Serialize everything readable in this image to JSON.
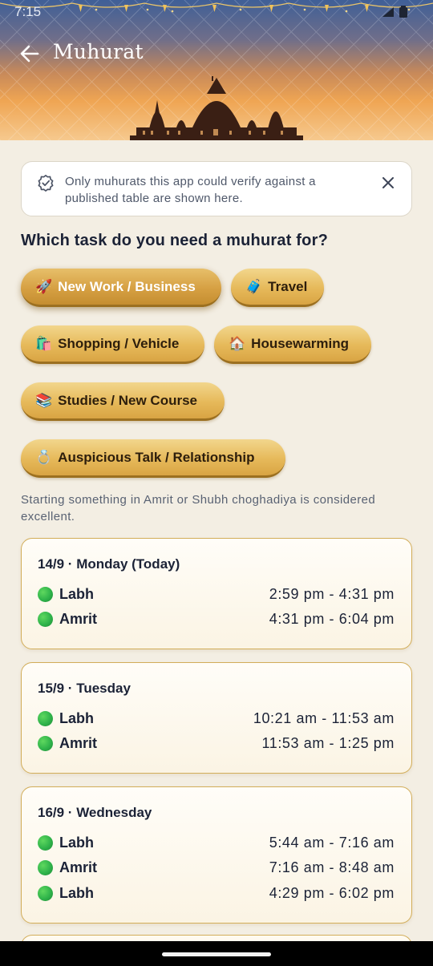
{
  "status_bar": {
    "time": "7:15"
  },
  "header": {
    "title": "Muhurat"
  },
  "notice": {
    "text": "Only muhurats this app could verify against a published table are shown here."
  },
  "question": "Which task do you need a muhurat for?",
  "tasks": [
    {
      "emoji": "🚀",
      "label": "New Work / Business",
      "selected": true
    },
    {
      "emoji": "🧳",
      "label": "Travel",
      "selected": false
    },
    {
      "emoji": "🛍️",
      "label": "Shopping / Vehicle",
      "selected": false
    },
    {
      "emoji": "🏠",
      "label": "Housewarming",
      "selected": false
    },
    {
      "emoji": "📚",
      "label": "Studies / New Course",
      "selected": false
    },
    {
      "emoji": "💍",
      "label": "Auspicious Talk / Relationship",
      "selected": false
    }
  ],
  "hint": "Starting something in Amrit or Shubh choghadiya is considered excellent.",
  "days": [
    {
      "day": "14/9 · Monday (Today)",
      "slots": [
        {
          "name": "Labh",
          "time": "2:59 pm - 4:31 pm"
        },
        {
          "name": "Amrit",
          "time": "4:31 pm - 6:04 pm"
        }
      ]
    },
    {
      "day": "15/9 · Tuesday",
      "slots": [
        {
          "name": "Labh",
          "time": "10:21 am - 11:53 am"
        },
        {
          "name": "Amrit",
          "time": "11:53 am - 1:25 pm"
        }
      ]
    },
    {
      "day": "16/9 · Wednesday",
      "slots": [
        {
          "name": "Labh",
          "time": "5:44 am - 7:16 am"
        },
        {
          "name": "Amrit",
          "time": "7:16 am - 8:48 am"
        },
        {
          "name": "Labh",
          "time": "4:29 pm - 6:02 pm"
        }
      ]
    }
  ],
  "colors": {
    "accent_gold": "#d9a443",
    "good_slot": "#2fb34a",
    "background": "#f3eee3"
  }
}
